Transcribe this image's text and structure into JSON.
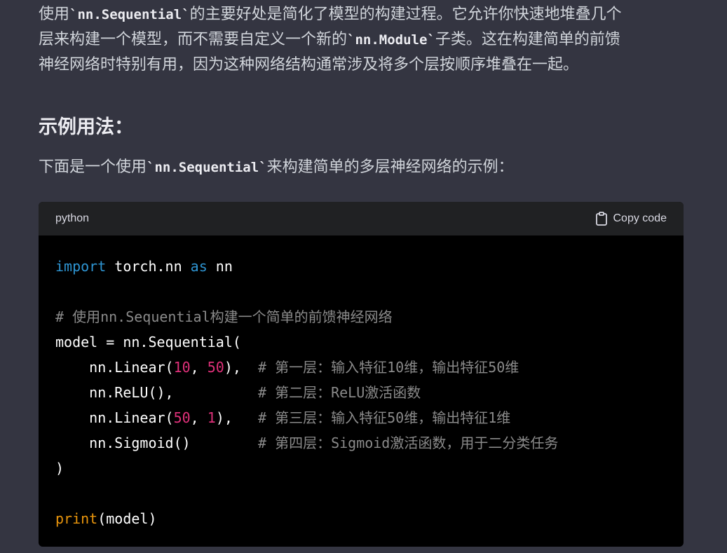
{
  "prose": {
    "para1": {
      "l1a": "使用",
      "l1code": "`nn.Sequential`",
      "l1b": "的主要好处是简化了模型的构建过程。它允许你快速地堆叠几个",
      "l2a": "层来构建一个模型，而不需要自定义一个新的",
      "l2code": "`nn.Module`",
      "l2b": "子类。这在构建简单的前馈",
      "l3": "神经网络时特别有用，因为这种网络结构通常涉及将多个层按顺序堆叠在一起。"
    },
    "heading": "示例用法：",
    "para2": {
      "a": "下面是一个使用",
      "code": "`nn.Sequential`",
      "b": "来构建简单的多层神经网络的示例："
    }
  },
  "code_block": {
    "language": "python",
    "copy_label": "Copy code",
    "lines": {
      "l1": {
        "kw1": "import",
        "t1": " torch.nn ",
        "kw2": "as",
        "t2": " nn"
      },
      "l3": {
        "comment": "# 使用nn.Sequential构建一个简单的前馈神经网络"
      },
      "l4": {
        "text": "model = nn.Sequential("
      },
      "l5": {
        "t1": "    nn.Linear(",
        "n1": "10",
        "t2": ", ",
        "n2": "50",
        "t3": "),  ",
        "comment": "# 第一层：输入特征10维，输出特征50维"
      },
      "l6": {
        "t1": "    nn.ReLU(),          ",
        "comment": "# 第二层：ReLU激活函数"
      },
      "l7": {
        "t1": "    nn.Linear(",
        "n1": "50",
        "t2": ", ",
        "n2": "1",
        "t3": "),   ",
        "comment": "# 第三层：输入特征50维，输出特征1维"
      },
      "l8": {
        "t1": "    nn.Sigmoid()        ",
        "comment": "# 第四层：Sigmoid激活函数，用于二分类任务"
      },
      "l9": {
        "text": ")"
      },
      "l11": {
        "builtin": "print",
        "t1": "(model)"
      }
    }
  },
  "colors": {
    "background": "#343541",
    "code_header": "#202123",
    "code_body": "#000000",
    "keyword": "#2e95d3",
    "number": "#df3079",
    "comment": "#8a8a8a",
    "builtin": "#e9950c"
  },
  "icons": {
    "copy": "clipboard-icon"
  }
}
